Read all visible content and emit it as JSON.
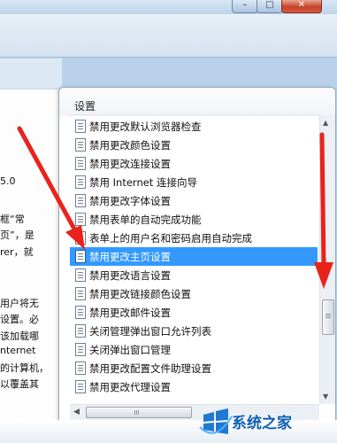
{
  "window": {
    "minimize_glyph": "–",
    "maximize_glyph": "□",
    "close_glyph": "✕"
  },
  "background_page": {
    "fragments": [
      "5.0",
      "框“常",
      "页”，是",
      "rer，就",
      "用户将无",
      "设置。必",
      "该加载哪",
      "nternet",
      "的计算机，",
      "以覆盖其"
    ]
  },
  "settings": {
    "title": "设置",
    "items": [
      {
        "label": "禁用更改默认浏览器检查"
      },
      {
        "label": "禁用更改颜色设置"
      },
      {
        "label": "禁用更改连接设置"
      },
      {
        "label": "禁用 Internet 连接向导"
      },
      {
        "label": "禁用更改字体设置"
      },
      {
        "label": "禁用表单的自动完成功能"
      },
      {
        "label": "表单上的用户名和密码启用自动完成"
      },
      {
        "label": "禁用更改主页设置"
      },
      {
        "label": "禁用更改语言设置"
      },
      {
        "label": "禁用更改链接颜色设置"
      },
      {
        "label": "禁用更改邮件设置"
      },
      {
        "label": "关闭管理弹出窗口允许列表"
      },
      {
        "label": "关闭弹出窗口管理"
      },
      {
        "label": "禁用更改配置文件助理设置"
      },
      {
        "label": "禁用更改代理设置"
      }
    ],
    "selected_item": "禁用更改主页设置"
  },
  "scrollbar": {
    "up_glyph": "▲",
    "down_glyph": "▼",
    "left_glyph": "◀"
  },
  "watermark": {
    "text": "系统之家"
  },
  "colors": {
    "selection": "#3399ff",
    "arrow": "#e8231c",
    "watermark": "#0f5fb0"
  }
}
